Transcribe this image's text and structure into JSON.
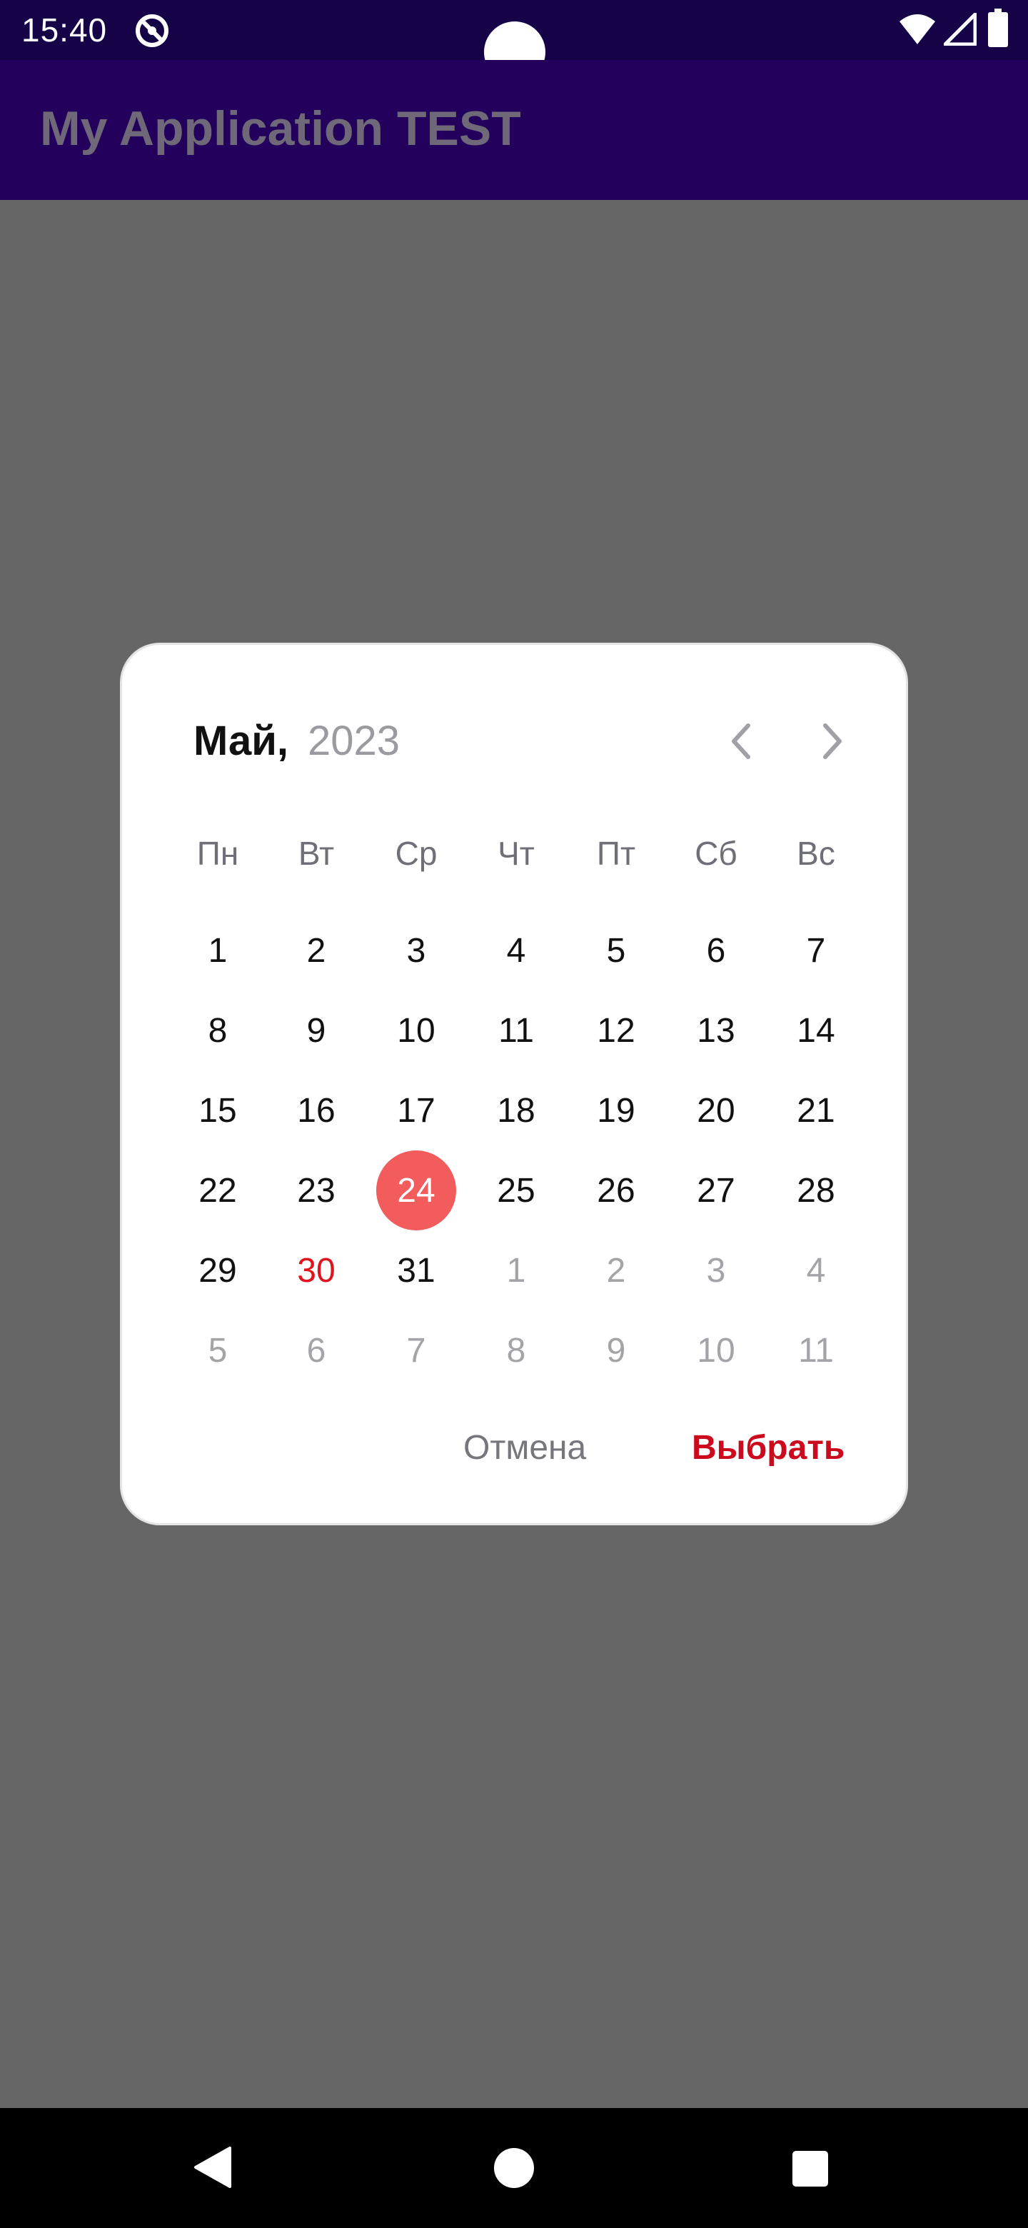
{
  "status_bar": {
    "time": "15:40",
    "icons": [
      "app-notification-icon",
      "wifi-icon",
      "cell-signal-icon",
      "battery-icon"
    ]
  },
  "app_bar": {
    "title": "My Application TEST"
  },
  "dialog": {
    "month": "Май,",
    "year": "2023",
    "prev_icon": "chevron-left-icon",
    "next_icon": "chevron-right-icon",
    "weekdays": [
      "Пн",
      "Вт",
      "Ср",
      "Чт",
      "Пт",
      "Сб",
      "Вс"
    ],
    "weeks": [
      [
        {
          "d": "1"
        },
        {
          "d": "2"
        },
        {
          "d": "3"
        },
        {
          "d": "4"
        },
        {
          "d": "5"
        },
        {
          "d": "6"
        },
        {
          "d": "7"
        }
      ],
      [
        {
          "d": "8"
        },
        {
          "d": "9"
        },
        {
          "d": "10"
        },
        {
          "d": "11"
        },
        {
          "d": "12"
        },
        {
          "d": "13"
        },
        {
          "d": "14"
        }
      ],
      [
        {
          "d": "15"
        },
        {
          "d": "16"
        },
        {
          "d": "17"
        },
        {
          "d": "18"
        },
        {
          "d": "19"
        },
        {
          "d": "20"
        },
        {
          "d": "21"
        }
      ],
      [
        {
          "d": "22"
        },
        {
          "d": "23"
        },
        {
          "d": "24",
          "state": "selected"
        },
        {
          "d": "25"
        },
        {
          "d": "26"
        },
        {
          "d": "27"
        },
        {
          "d": "28"
        }
      ],
      [
        {
          "d": "29"
        },
        {
          "d": "30",
          "state": "today"
        },
        {
          "d": "31"
        },
        {
          "d": "1",
          "state": "other"
        },
        {
          "d": "2",
          "state": "other"
        },
        {
          "d": "3",
          "state": "other"
        },
        {
          "d": "4",
          "state": "other"
        }
      ],
      [
        {
          "d": "5",
          "state": "other"
        },
        {
          "d": "6",
          "state": "other"
        },
        {
          "d": "7",
          "state": "other"
        },
        {
          "d": "8",
          "state": "other"
        },
        {
          "d": "9",
          "state": "other"
        },
        {
          "d": "10",
          "state": "other"
        },
        {
          "d": "11",
          "state": "other"
        }
      ]
    ],
    "cancel_label": "Отмена",
    "select_label": "Выбрать"
  },
  "colors": {
    "status_bar": "#160247",
    "app_bar": "#23005c",
    "scrim": "#666666",
    "selected_day": "#f25c5c",
    "today_text": "#e0141e",
    "primary_action": "#cc0a1e"
  },
  "nav_bar": {
    "icons": [
      "back-icon",
      "home-icon",
      "recents-icon"
    ]
  }
}
